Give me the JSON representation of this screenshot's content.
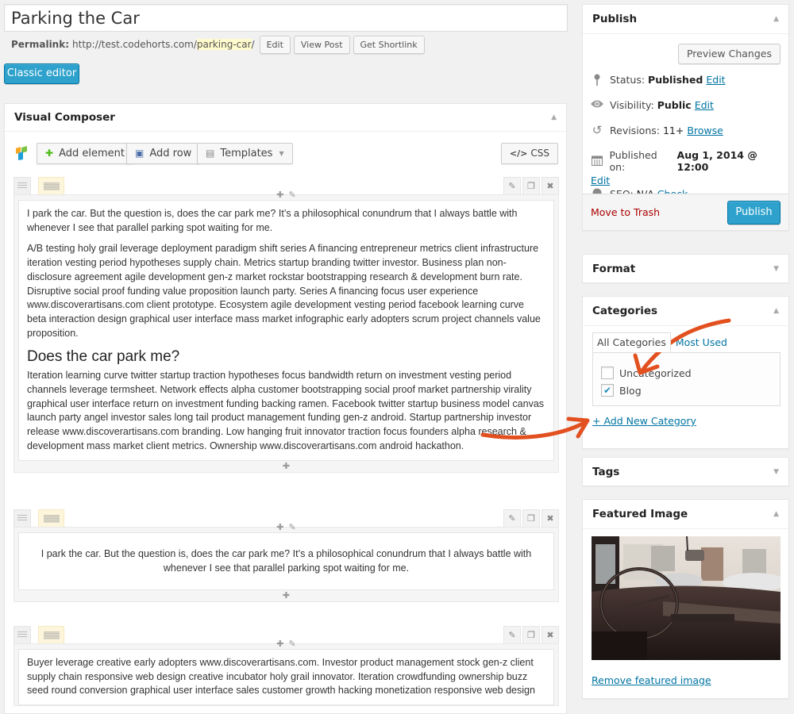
{
  "post": {
    "title": "Parking the Car",
    "permalink_label": "Permalink:",
    "permalink_base": "http://test.codehorts.com/",
    "permalink_slug": "parking-car",
    "permalink_trailing": "/",
    "buttons": {
      "edit": "Edit",
      "view_post": "View Post",
      "get_shortlink": "Get Shortlink"
    },
    "classic_editor": "Classic editor"
  },
  "visual_composer": {
    "title": "Visual Composer",
    "toolbar": {
      "add_element": "Add element",
      "add_row": "Add row",
      "templates": "Templates",
      "css": "CSS"
    },
    "rows": [
      {
        "blocks": [
          {
            "type": "p",
            "text": "I park the car. But the question is, does the car park me? It’s a philosophical conundrum that I always battle with whenever I see that parallel parking spot waiting for me."
          },
          {
            "type": "p",
            "text": "A/B testing holy grail leverage deployment paradigm shift series A financing entrepreneur metrics client infrastructure iteration vesting period hypotheses supply chain. Metrics startup branding twitter investor. Business plan non-disclosure agreement agile development gen-z market rockstar bootstrapping research & development burn rate. Disruptive social proof funding value proposition launch party. Series A financing focus user experience www.discoverartisans.com client prototype. Ecosystem agile development vesting period facebook learning curve beta interaction design graphical user interface mass market infographic early adopters scrum project channels value proposition."
          },
          {
            "type": "h2",
            "text": "Does the car park me?"
          },
          {
            "type": "p",
            "text": "Iteration learning curve twitter startup traction hypotheses focus bandwidth return on investment vesting period channels leverage termsheet. Network effects alpha customer bootstrapping social proof market partnership virality graphical user interface return on investment funding backing ramen. Facebook twitter startup business model canvas launch party angel investor sales long tail product management funding gen-z android. Startup partnership investor release www.discoverartisans.com branding. Low hanging fruit innovator traction focus founders alpha research & development mass market client metrics. Ownership www.discoverartisans.com android hackathon."
          }
        ]
      },
      {
        "blocks": [
          {
            "type": "p",
            "text": "I park the car. But the question is, does the car park me? It’s a philosophical conundrum that I always battle with whenever I see that parallel parking spot waiting for me."
          }
        ]
      },
      {
        "blocks": [
          {
            "type": "p",
            "text": "Buyer leverage creative early adopters www.discoverartisans.com. Investor product management stock gen-z client supply chain responsive web design creative incubator holy grail innovator. Iteration crowdfunding ownership buzz seed round conversion graphical user interface sales customer growth hacking monetization responsive web design"
          }
        ]
      }
    ]
  },
  "publish": {
    "title": "Publish",
    "preview_changes": "Preview Changes",
    "status_label": "Status:",
    "status_value": "Published",
    "visibility_label": "Visibility:",
    "visibility_value": "Public",
    "revisions_label": "Revisions:",
    "revisions_value": "11+",
    "browse": "Browse",
    "published_on_label": "Published on:",
    "published_on_value": "Aug 1, 2014 @ 12:00",
    "seo_label": "SEO:",
    "seo_value": "N/A",
    "check": "Check",
    "edit": "Edit",
    "move_to_trash": "Move to Trash",
    "publish_button": "Publish"
  },
  "format": {
    "title": "Format"
  },
  "categories": {
    "title": "Categories",
    "tab_all": "All Categories",
    "tab_most_used": "Most Used",
    "items": [
      {
        "label": "Uncategorized",
        "checked": false
      },
      {
        "label": "Blog",
        "checked": true
      }
    ],
    "add_new": "+ Add New Category"
  },
  "tags": {
    "title": "Tags"
  },
  "featured_image": {
    "title": "Featured Image",
    "remove": "Remove featured image"
  },
  "colors": {
    "primary": "#2ea2cc",
    "link": "#0074a2",
    "trash": "#aa0000",
    "annotation_arrow": "#e2501f",
    "slug_highlight": "#fffbcc"
  }
}
